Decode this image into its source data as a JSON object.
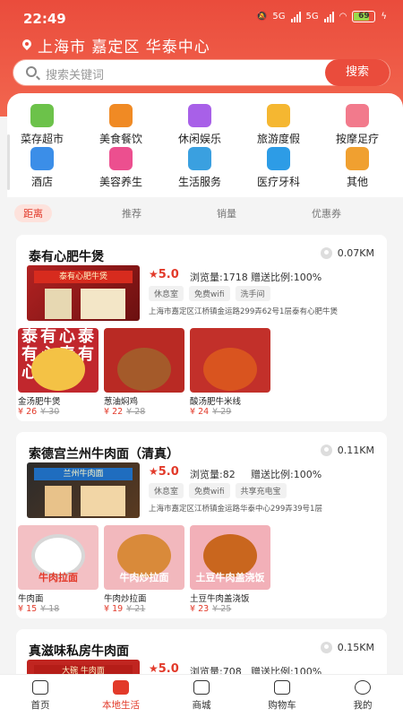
{
  "status": {
    "time": "22:49",
    "signal1": "5G",
    "signal2": "5G",
    "battery": "69"
  },
  "location": "上海市 嘉定区 华泰中心",
  "search": {
    "placeholder": "搜索关键词",
    "button": "搜索"
  },
  "categories": [
    {
      "label": "菜存超市",
      "icon": "basket-icon"
    },
    {
      "label": "美食餐饮",
      "icon": "utensils-icon"
    },
    {
      "label": "休闲娱乐",
      "icon": "gamepad-icon"
    },
    {
      "label": "旅游度假",
      "icon": "island-icon"
    },
    {
      "label": "按摩足疗",
      "icon": "foot-icon"
    },
    {
      "label": "酒店",
      "icon": "hotel-icon"
    },
    {
      "label": "美容养生",
      "icon": "flower-icon"
    },
    {
      "label": "生活服务",
      "icon": "tools-icon"
    },
    {
      "label": "医疗牙科",
      "icon": "medical-icon"
    },
    {
      "label": "其他",
      "icon": "grid-icon"
    }
  ],
  "sort_tabs": [
    "距离",
    "推荐",
    "销量",
    "优惠券"
  ],
  "stores": [
    {
      "name": "泰有心肥牛煲",
      "distance": "0.07KM",
      "rating": "5.0",
      "views": "浏览量:1718",
      "ratio": "赠送比例:100%",
      "tags": [
        "休息室",
        "免费wifi",
        "洗手间"
      ],
      "address": "上海市嘉定区江桥镇金运路299弄62号1层泰有心肥牛煲",
      "sign": "泰有心肥牛煲",
      "banner": "泰有心泰有心泰有心",
      "dishes": [
        {
          "name": "金汤肥牛煲",
          "price": "¥ 26",
          "old": "¥ 30",
          "label": ""
        },
        {
          "name": "葱油焖鸡",
          "price": "¥ 22",
          "old": "¥ 28",
          "label": ""
        },
        {
          "name": "酸汤肥牛米线",
          "price": "¥ 24",
          "old": "¥ 29",
          "label": ""
        }
      ]
    },
    {
      "name": "索德宫兰州牛肉面（清真）",
      "distance": "0.11KM",
      "rating": "5.0",
      "views": "浏览量:82",
      "ratio": "赠送比例:100%",
      "tags": [
        "休息室",
        "免费wifi",
        "共享充电宝"
      ],
      "address": "上海市嘉定区江桥镇金运路华泰中心299弄39号1层",
      "sign": "兰州牛肉面",
      "dishes": [
        {
          "name": "牛肉面",
          "price": "¥ 15",
          "old": "¥ 18",
          "label": "牛肉拉面"
        },
        {
          "name": "牛肉炒拉面",
          "price": "¥ 19",
          "old": "¥ 21",
          "label": "牛肉炒拉面"
        },
        {
          "name": "土豆牛肉盖浇饭",
          "price": "¥ 23",
          "old": "¥ 25",
          "label": "土豆牛肉盖浇饭"
        }
      ]
    },
    {
      "name": "真滋味私房牛肉面",
      "distance": "0.15KM",
      "rating": "5.0",
      "views": "浏览量:708",
      "ratio": "赠送比例:100%",
      "sign": "大碗 牛肉面"
    }
  ],
  "tabbar": [
    {
      "label": "首页",
      "icon": "home-icon"
    },
    {
      "label": "本地生活",
      "icon": "basket-icon"
    },
    {
      "label": "商城",
      "icon": "shop-icon"
    },
    {
      "label": "购物车",
      "icon": "cart-icon"
    },
    {
      "label": "我的",
      "icon": "user-icon"
    }
  ],
  "colors": {
    "primary": "#ea4c3c",
    "price": "#e23a2a"
  }
}
